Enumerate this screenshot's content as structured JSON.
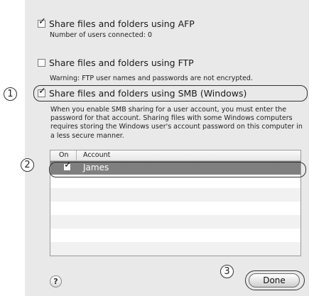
{
  "options": {
    "afp": {
      "label": "Share files and folders using AFP",
      "checked": true
    },
    "afp_note": "Number of users connected: 0",
    "ftp": {
      "label": "Share files and folders using FTP",
      "checked": false
    },
    "ftp_note": "Warning: FTP user names and passwords are not encrypted.",
    "smb": {
      "label": "Share files and folders using SMB (Windows)",
      "checked": true
    },
    "smb_desc": "When you enable SMB sharing for a user account, you must enter the password for that account. Sharing files with some Windows computers requires storing the Windows user's account password on this computer in a less secure manner."
  },
  "accounts_table": {
    "headers": {
      "on": "On",
      "account": "Account"
    },
    "rows": [
      {
        "on": true,
        "account": "James",
        "selected": true
      }
    ]
  },
  "buttons": {
    "help": "?",
    "done": "Done"
  },
  "callouts": [
    "1",
    "2",
    "3"
  ]
}
